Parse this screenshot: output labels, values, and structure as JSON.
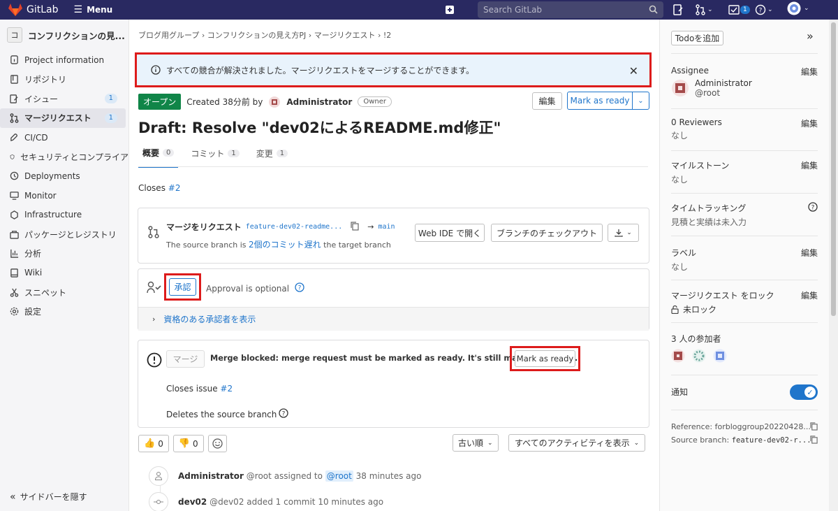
{
  "topbar": {
    "brand": "GitLab",
    "menu_label": "Menu",
    "search_placeholder": "Search GitLab",
    "todo_count": "1"
  },
  "sidebar": {
    "project_avatar": "コ",
    "project_name": "コンフリクションの見...",
    "items": [
      {
        "label": "Project information",
        "icon": "info-icon"
      },
      {
        "label": "リポジトリ",
        "icon": "repository-icon"
      },
      {
        "label": "イシュー",
        "icon": "issues-icon",
        "count": "1"
      },
      {
        "label": "マージリクエスト",
        "icon": "merge-request-icon",
        "count": "1"
      },
      {
        "label": "CI/CD",
        "icon": "rocket-icon"
      },
      {
        "label": "セキュリティとコンプライア",
        "icon": "shield-icon"
      },
      {
        "label": "Deployments",
        "icon": "deployments-icon"
      },
      {
        "label": "Monitor",
        "icon": "monitor-icon"
      },
      {
        "label": "Infrastructure",
        "icon": "cloud-icon"
      },
      {
        "label": "パッケージとレジストリ",
        "icon": "package-icon"
      },
      {
        "label": "分析",
        "icon": "chart-icon"
      },
      {
        "label": "Wiki",
        "icon": "book-icon"
      },
      {
        "label": "スニペット",
        "icon": "scissors-icon"
      },
      {
        "label": "設定",
        "icon": "settings-icon"
      }
    ],
    "collapse_label": "サイドバーを隠す"
  },
  "breadcrumb": [
    "ブログ用グループ",
    "コンフリクションの見え方PJ",
    "マージリクエスト",
    "!2"
  ],
  "alert": {
    "message": "すべての競合が解決されました。マージリクエストをマージすることができます。"
  },
  "mr": {
    "status": "オープン",
    "created": "Created 38分前 by",
    "author": "Administrator",
    "author_role": "Owner",
    "edit_label": "編集",
    "mark_ready_label": "Mark as ready",
    "title": "Draft: Resolve \"dev02によるREADME.md修正\"",
    "tabs": [
      {
        "label": "概要",
        "count": "0"
      },
      {
        "label": "コミット",
        "count": "1"
      },
      {
        "label": "変更",
        "count": "1"
      }
    ],
    "closes_prefix": "Closes",
    "closes_ref": "#2"
  },
  "merge_info": {
    "title": "マージをリクエスト",
    "source_branch": "feature-dev02-readme...",
    "arrow": "→",
    "target_branch": "main",
    "status_prefix": "The source branch is",
    "status_link": "2個のコミット遅れ",
    "status_suffix": "the target branch",
    "web_ide_label": "Web IDE で開く",
    "checkout_label": "ブランチのチェックアウト"
  },
  "approval": {
    "approve_label": "承認",
    "optional_text": "Approval is optional",
    "show_approvers": "資格のある承認者を表示"
  },
  "merge_widget": {
    "merge_label": "マージ",
    "blocked_text": "Merge blocked: merge request must be marked as ready. It's still marked as draft.",
    "mark_ready_label": "Mark as ready",
    "closes_issue_prefix": "Closes issue",
    "closes_issue_ref": "#2",
    "deletes_branch": "Deletes the source branch"
  },
  "reactions": {
    "thumbs_up": "0",
    "thumbs_down": "0",
    "sort_label": "古い順",
    "filter_label": "すべてのアクティビティを表示"
  },
  "activity": [
    {
      "user": "Administrator",
      "handle": "@root",
      "action": "assigned to",
      "target": "@root",
      "time": "38 minutes ago"
    },
    {
      "user": "dev02",
      "handle": "@dev02",
      "action": "added 1 commit",
      "time": "10 minutes ago"
    }
  ],
  "right_sidebar": {
    "todo_label": "Todoを追加",
    "assignee_label": "Assignee",
    "assignee_name": "Administrator",
    "assignee_handle": "@root",
    "edit_label": "編集",
    "reviewers_label": "0 Reviewers",
    "reviewers_value": "なし",
    "milestone_label": "マイルストーン",
    "milestone_value": "なし",
    "time_tracking_label": "タイムトラッキング",
    "time_tracking_value": "見積と実績は未入力",
    "labels_label": "ラベル",
    "labels_value": "なし",
    "lock_label": "マージリクエスト をロック",
    "lock_value": "未ロック",
    "participants_label": "3 人の参加者",
    "notifications_label": "通知",
    "reference": "Reference: forbloggroup20220428...",
    "source_branch_prefix": "Source branch:",
    "source_branch": "feature-dev02-r..."
  }
}
